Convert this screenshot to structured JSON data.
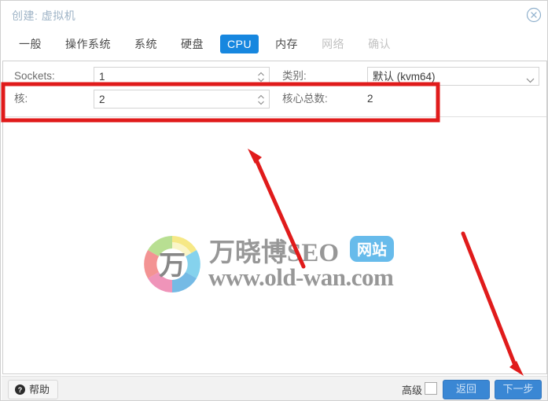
{
  "window": {
    "title": "创建: 虚拟机",
    "close_icon": "close-circle-icon"
  },
  "tabs": [
    {
      "label": "一般",
      "state": "normal"
    },
    {
      "label": "操作系统",
      "state": "normal"
    },
    {
      "label": "系统",
      "state": "normal"
    },
    {
      "label": "硬盘",
      "state": "normal"
    },
    {
      "label": "CPU",
      "state": "active"
    },
    {
      "label": "内存",
      "state": "normal"
    },
    {
      "label": "网络",
      "state": "disabled"
    },
    {
      "label": "确认",
      "state": "disabled"
    }
  ],
  "form": {
    "sockets": {
      "label": "Sockets:",
      "value": "1"
    },
    "cores": {
      "label": "核:",
      "value": "2"
    },
    "type": {
      "label": "类别:",
      "value": "默认 (kvm64)"
    },
    "total_cores": {
      "label": "核心总数:",
      "value": "2"
    }
  },
  "watermark": {
    "brand": "万晓博SEO",
    "badge": "网站",
    "url": "www.old-wan.com",
    "logo_glyph": "万"
  },
  "footer": {
    "help_label": "帮助",
    "help_icon": "question-mark-icon",
    "advanced_label": "高级",
    "advanced_checked": false,
    "back_label": "返回",
    "next_label": "下一步"
  },
  "colors": {
    "accent_blue": "#1787df",
    "button_blue": "#3a87d4",
    "annotation_red": "#e01b1b",
    "title_blue": "#9fb4c7",
    "badge_blue": "#5bb6ea"
  },
  "annotations": {
    "highlight_box": "red-rectangle-around-cores-row",
    "arrow_1": "red-arrow-up-left-to-cores-field",
    "arrow_2": "red-arrow-down-right-to-next-button"
  }
}
